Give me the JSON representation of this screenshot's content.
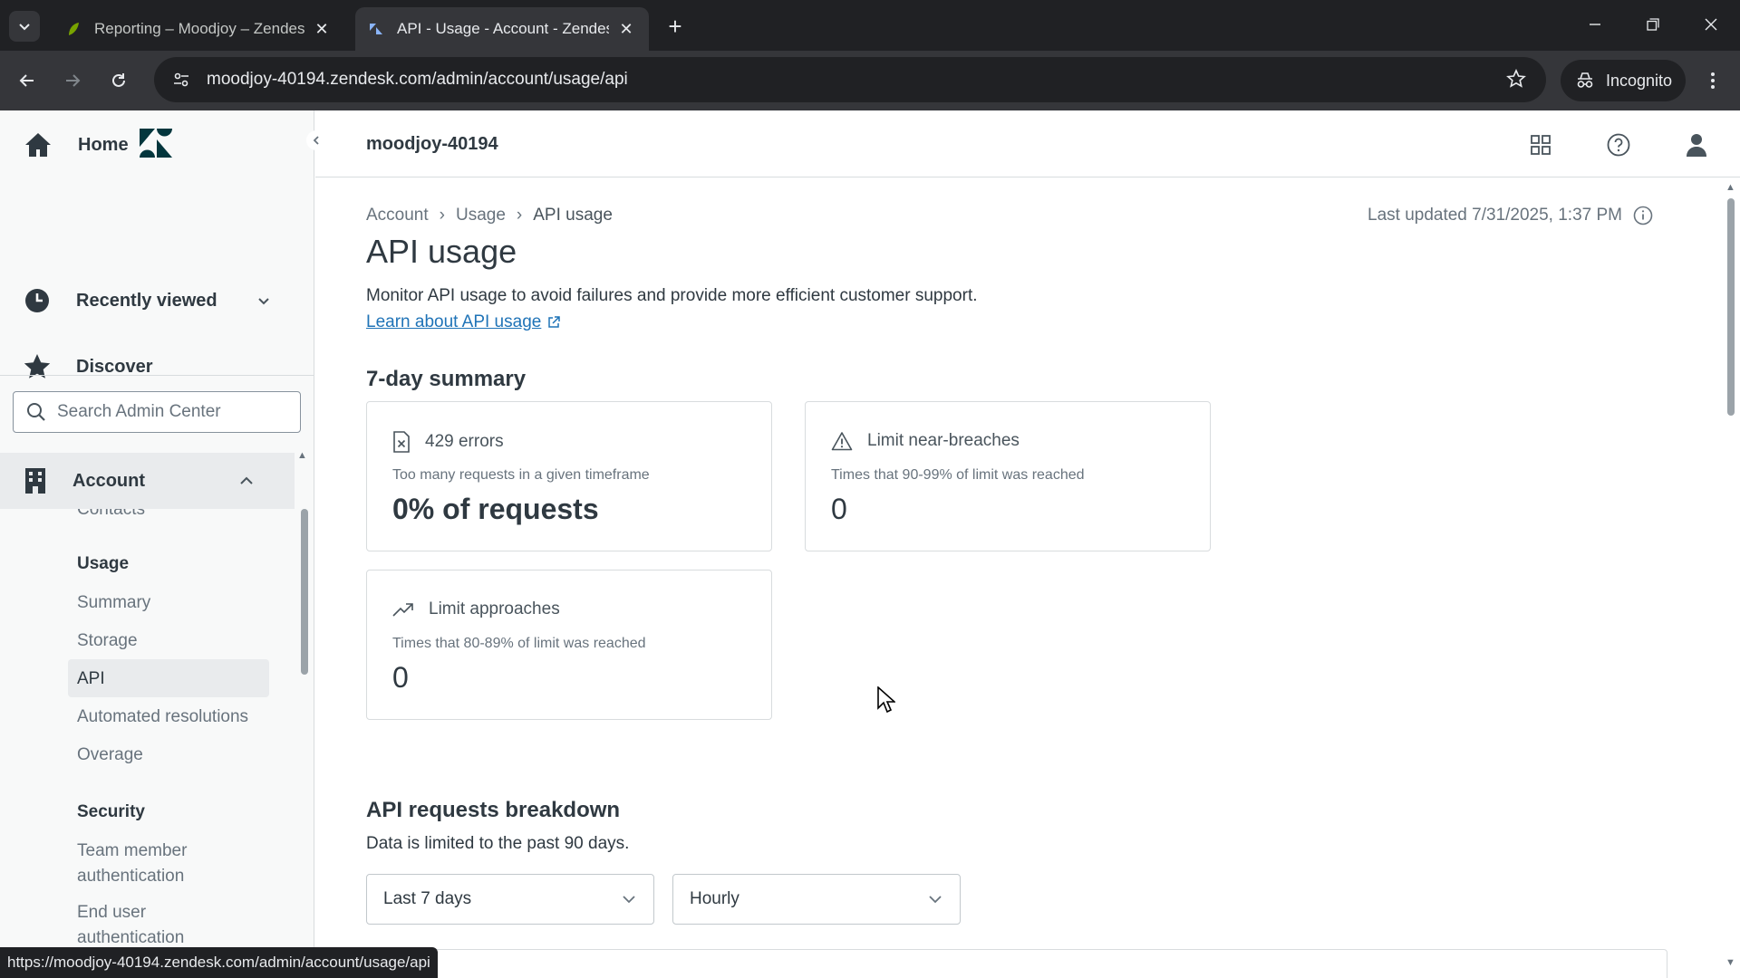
{
  "browser": {
    "tabs": [
      {
        "title": "Reporting – Moodjoy – Zendesk",
        "active": false
      },
      {
        "title": "API - Usage - Account - Zendesk",
        "active": true
      }
    ],
    "url": "moodjoy-40194.zendesk.com/admin/account/usage/api",
    "incognito_label": "Incognito",
    "status_url": "https://moodjoy-40194.zendesk.com/admin/account/usage/api"
  },
  "sidebar": {
    "nav": [
      {
        "label": "Home",
        "icon": "home-icon"
      },
      {
        "label": "Recently viewed",
        "icon": "clock-icon"
      },
      {
        "label": "Discover",
        "icon": "star-icon"
      }
    ],
    "search_placeholder": "Search Admin Center",
    "account_label": "Account",
    "partial_item": "Contacts",
    "usage_heading": "Usage",
    "usage_items": [
      "Summary",
      "Storage",
      "API",
      "Automated resolutions",
      "Overage"
    ],
    "security_heading": "Security",
    "security_items": [
      "Team member authentication",
      "End user authentication"
    ]
  },
  "topbar": {
    "account_name": "moodjoy-40194"
  },
  "main": {
    "breadcrumb": [
      "Account",
      "Usage",
      "API usage"
    ],
    "last_updated": "Last updated 7/31/2025, 1:37 PM",
    "title": "API usage",
    "description": "Monitor API usage to avoid failures and provide more efficient customer support.",
    "learn_link": "Learn about API usage",
    "summary_title": "7-day summary",
    "cards": [
      {
        "title": "429 errors",
        "subtitle": "Too many requests in a given timeframe",
        "value": "0% of requests",
        "icon": "error-file-icon"
      },
      {
        "title": "Limit near-breaches",
        "subtitle": "Times that 90-99% of limit was reached",
        "value": "0",
        "icon": "warning-icon"
      },
      {
        "title": "Limit approaches",
        "subtitle": "Times that 80-89% of limit was reached",
        "value": "0",
        "icon": "trend-up-icon"
      }
    ],
    "breakdown_title": "API requests breakdown",
    "breakdown_desc": "Data is limited to the past 90 days.",
    "period_select": "Last 7 days",
    "interval_select": "Hourly"
  },
  "colors": {
    "accent_link": "#1f73b7",
    "text_primary": "#2f3941",
    "chrome_dark": "#202124"
  }
}
